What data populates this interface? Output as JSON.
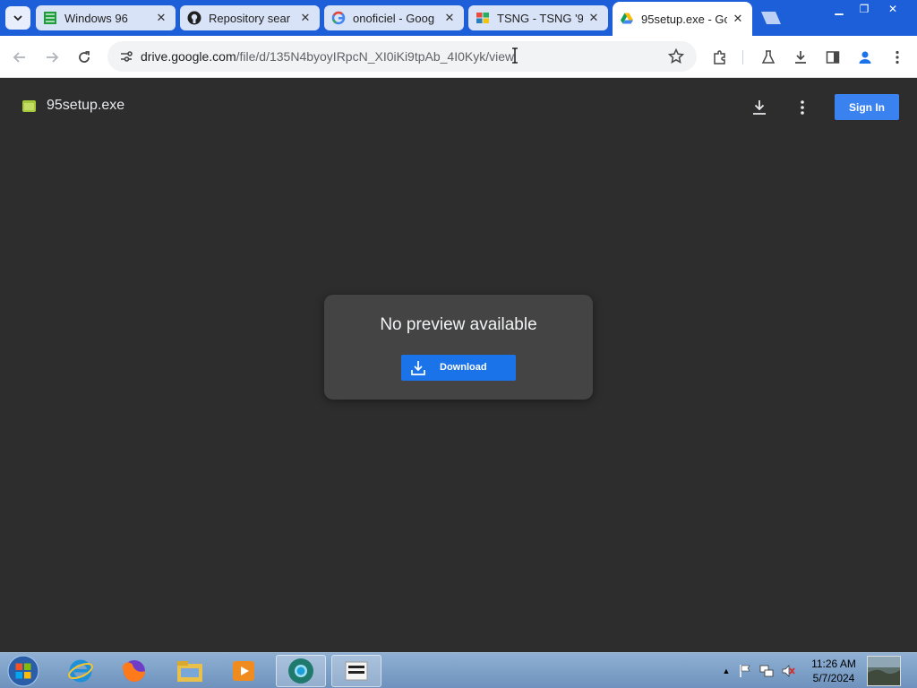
{
  "browser": {
    "tabs": [
      {
        "title": "Windows 96",
        "icon": "windows96-icon"
      },
      {
        "title": "Repository sear",
        "icon": "github-icon"
      },
      {
        "title": "onoficiel - Goog",
        "icon": "google-icon"
      },
      {
        "title": "TSNG - TSNG '9",
        "icon": "windows-flag-icon"
      },
      {
        "title": "95setup.exe - Gc",
        "icon": "google-drive-icon",
        "active": true
      }
    ],
    "address": {
      "host": "drive.google.com",
      "path": "/file/d/135N4byoyIRpcN_XI0iKi9tpAb_4I0Kyk/view"
    }
  },
  "viewer": {
    "file_name": "95setup.exe",
    "sign_in_label": "Sign In",
    "no_preview_text": "No preview available",
    "download_label": "Download"
  },
  "taskbar": {
    "pinned": [
      "internet-explorer-icon",
      "firefox-icon",
      "file-explorer-icon",
      "media-player-icon",
      "chrome-icon",
      "app-icon"
    ],
    "time": "11:26 AM",
    "date": "5/7/2024"
  },
  "colors": {
    "tabstrip": "#1c5fd9",
    "viewer_bg": "#2d2d2d",
    "dialog_bg": "#444444",
    "download_button": "#1a73e8",
    "sign_in_button": "#3b82f1"
  }
}
